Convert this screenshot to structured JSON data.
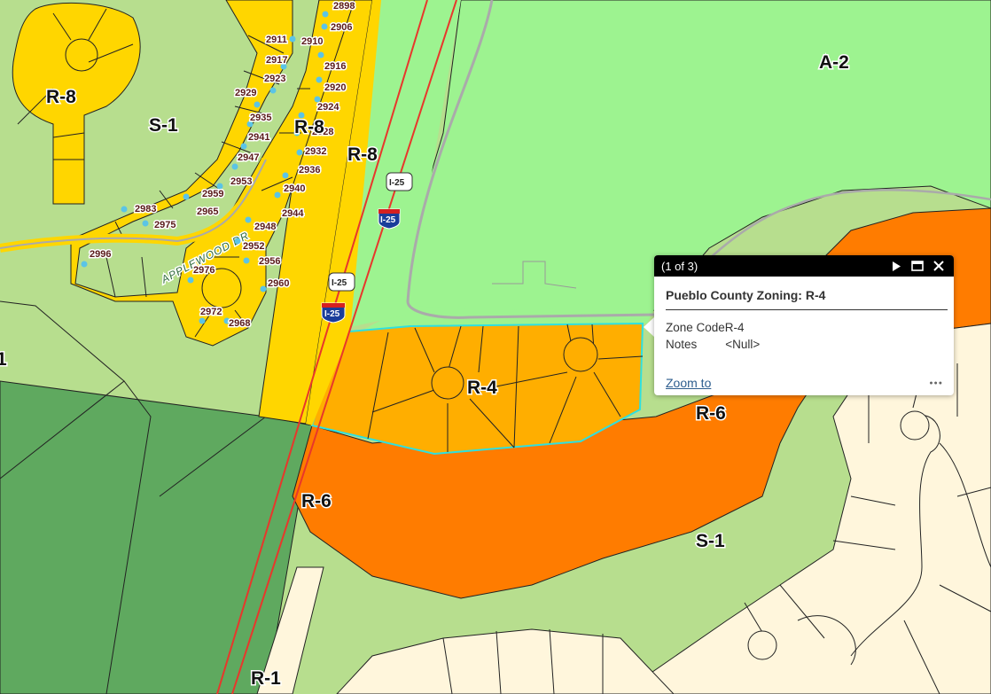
{
  "map": {
    "zones": {
      "a2": "A-2",
      "r8_left": "R-8",
      "s1_left": "S-1",
      "r8_partial": "R-8",
      "r8_center": "R-8",
      "r4": "R-4",
      "r6_right": "R-6",
      "r6_left": "R-6",
      "s1_right": "S-1",
      "r1": "R-1",
      "edge_1": "1"
    },
    "street": "APPLEWOOD DR",
    "highway_shields": [
      "I-25",
      "I-25",
      "I-25",
      "I-25"
    ],
    "addresses": [
      "2898",
      "2906",
      "2911",
      "2910",
      "2917",
      "2916",
      "2923",
      "2920",
      "2929",
      "2924",
      "2935",
      "2928",
      "2941",
      "2932",
      "2947",
      "2936",
      "2953",
      "2940",
      "2959",
      "2944",
      "2983",
      "2965",
      "2948",
      "2975",
      "2952",
      "2996",
      "2956",
      "2976",
      "2960",
      "2972",
      "2968"
    ],
    "colors": {
      "a2": "#9df390",
      "r8": "#ffd600",
      "s1": "#b7de8e",
      "dark_green": "#5fa95f",
      "r4": "#ffae00",
      "r6": "#ff7c00",
      "r1": "#fff6dc",
      "highlight": "#2ee0e0",
      "road": "#e8372b"
    }
  },
  "popup": {
    "count": "(1 of 3)",
    "title": "Pueblo County Zoning: R-4",
    "zone_code_label": "Zone Code",
    "zone_code_value": "R-4",
    "notes_label": "Notes",
    "notes_value": "<Null>",
    "zoom_link": "Zoom to",
    "more_icon": "ellipsis-icon",
    "next_icon": "play-icon",
    "maximize_icon": "maximize-icon",
    "close_icon": "close-icon"
  }
}
